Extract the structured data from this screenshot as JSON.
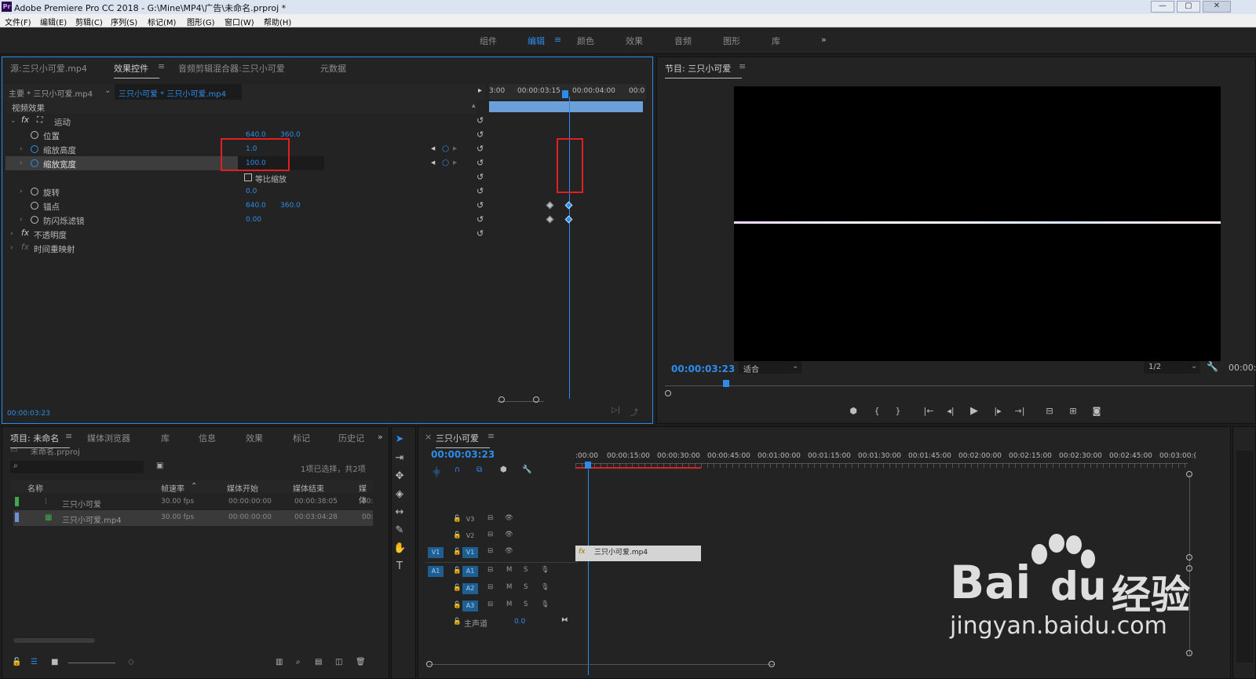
{
  "window": {
    "title": "Adobe Premiere Pro CC 2018 - G:\\Mine\\MP4\\广告\\未命名.prproj *",
    "logo": "Pr",
    "controls": [
      "min-icon",
      "max-icon",
      "close-icon"
    ]
  },
  "menu": [
    "文件(F)",
    "编辑(E)",
    "剪辑(C)",
    "序列(S)",
    "标记(M)",
    "图形(G)",
    "窗口(W)",
    "帮助(H)"
  ],
  "workspaces": {
    "items": [
      "组件",
      "编辑",
      "颜色",
      "效果",
      "音频",
      "图形",
      "库"
    ],
    "active": "编辑",
    "more": "»"
  },
  "effectPanel": {
    "tabs": [
      "源:三只小可爱.mp4",
      "效果控件",
      "音频剪辑混合器:三只小可爱",
      "元数据"
    ],
    "activeTab": "效果控件",
    "master": "主要 * 三只小可爱.mp4",
    "clip": "三只小可爱 * 三只小可爱.mp4",
    "rulerTimes": [
      "3:00",
      "00:00:03:15",
      "00:00:04:00",
      "00:0"
    ],
    "section": "视频效果",
    "motion": "运动",
    "properties": [
      {
        "name": "位置",
        "v1": "640.0",
        "v2": "360.0"
      },
      {
        "name": "缩放高度",
        "v1": "1.0",
        "v2": "",
        "keyframes": true
      },
      {
        "name": "缩放宽度",
        "v1": "100.0",
        "v2": "",
        "keyframes": true,
        "selected": true
      },
      {
        "name": "等比缩放",
        "checkbox": true
      },
      {
        "name": "旋转",
        "v1": "0.0",
        "v2": ""
      },
      {
        "name": "锚点",
        "v1": "640.0",
        "v2": "360.0"
      },
      {
        "name": "防闪烁滤镜",
        "v1": "0.00",
        "v2": ""
      }
    ],
    "opacity": "不透明度",
    "timeRemap": "时间重映射",
    "timecode": "00:00:03:23"
  },
  "program": {
    "title": "节目: 三只小可爱",
    "timecode": "00:00:03:23",
    "fit": "适合",
    "resolution": "1/2",
    "duration": "00:00:"
  },
  "project": {
    "tabs": [
      "项目: 未命名",
      "媒体浏览器",
      "库",
      "信息",
      "效果",
      "标记",
      "历史记"
    ],
    "file": "未命名.prproj",
    "selection": "1项已选择，共2项",
    "columns": [
      "名称",
      "帧速率",
      "媒体开始",
      "媒体结束",
      "媒体"
    ],
    "rows": [
      {
        "name": "三只小可爱",
        "fps": "30.00 fps",
        "start": "00:00:00:00",
        "end": "00:00:38:05",
        "media": "00:",
        "color": "#3fa84a"
      },
      {
        "name": "三只小可爱.mp4",
        "fps": "30.00 fps",
        "start": "00:00:00:00",
        "end": "00:03:04:28",
        "media": "00:",
        "color": "#6f8fd6"
      }
    ]
  },
  "timeline": {
    "title": "三只小可爱",
    "timecode": "00:00:03:23",
    "ruler": [
      ":00:00",
      "00:00:15:00",
      "00:00:30:00",
      "00:00:45:00",
      "00:01:00:00",
      "00:01:15:00",
      "00:01:30:00",
      "00:01:45:00",
      "00:02:00:00",
      "00:02:15:00",
      "00:02:30:00",
      "00:02:45:00",
      "00:03:00:("
    ],
    "videoTracks": [
      "V3",
      "V2",
      "V1"
    ],
    "audioTracks": [
      "A1",
      "A2",
      "A3"
    ],
    "sourcePatch": {
      "video": "V1",
      "audio": "A1"
    },
    "master": {
      "label": "主声道",
      "value": "0.0"
    },
    "clip": "三只小可爱.mp4",
    "m": "M",
    "s": "S"
  },
  "watermark": {
    "text": "jingyan.baidu.com",
    "brand": "Bai",
    "brand2": "经验"
  },
  "colors": {
    "accent": "#2d8ceb",
    "highlight": "#e02020",
    "bg": "#232323"
  }
}
